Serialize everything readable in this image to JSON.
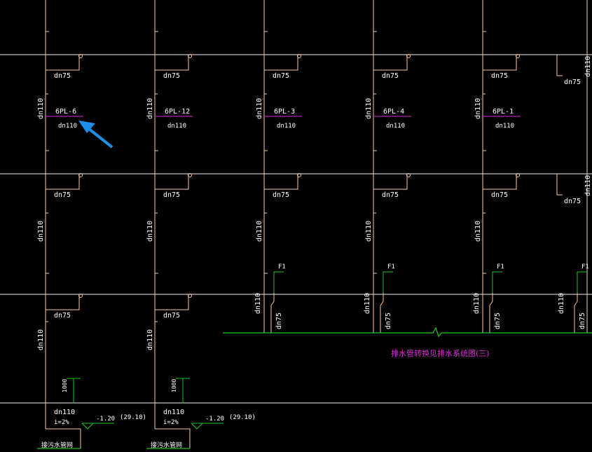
{
  "colors": {
    "background": "#000000",
    "pipe": "#f3c8a8",
    "floor_line": "#f5f1e4",
    "label_line": "#d92ad9",
    "drain": "#22c52a",
    "note_text": "#d92ad9",
    "arrow": "#1e8fe6",
    "text": "#ffffff"
  },
  "pipe_ids": [
    "6PL-6",
    "6PL-12",
    "6PL-3",
    "6PL-4",
    "6PL-1"
  ],
  "labels": {
    "dn75": "dn75",
    "dn110": "dn110",
    "dn110_lower": "dn110",
    "dn110_lower2": "dn110",
    "f1": "F1",
    "h1000": "1000",
    "bottom_dn": "dn110",
    "slope": "i=2%",
    "elev": "-1.20",
    "ref_elev": "(29.10)",
    "sewer_well": "接污水管网",
    "note": "排水管转换见排水系统图(三)"
  }
}
